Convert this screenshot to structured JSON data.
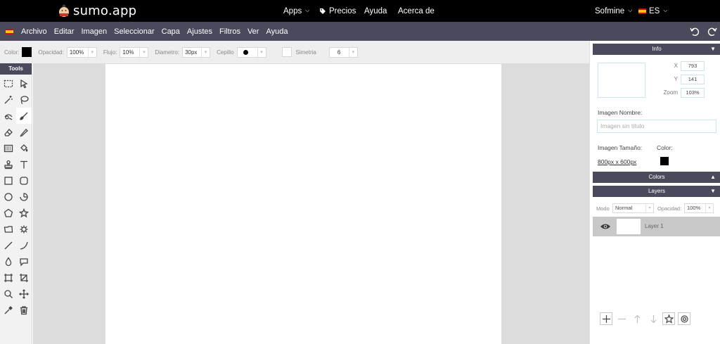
{
  "site": {
    "logo_text": "sumo.app",
    "nav": [
      {
        "label": "Apps",
        "icon": "chevron-down-icon"
      },
      {
        "label": "Precios",
        "icon": "tag-icon"
      },
      {
        "label": "Ayuda"
      },
      {
        "label": "Acerca de"
      }
    ],
    "user": "Sofmine",
    "language": "ES"
  },
  "menu": {
    "items": [
      "Archivo",
      "Editar",
      "Imagen",
      "Seleccionar",
      "Capa",
      "Ajustes",
      "Filtros",
      "Ver",
      "Ayuda"
    ]
  },
  "options": {
    "color_label": "Color:",
    "color_value": "#000000",
    "opacity_label": "Opacidad:",
    "opacity_value": "100%",
    "flow_label": "Flujo:",
    "flow_value": "10%",
    "diameter_label": "Diametro:",
    "diameter_value": "30px",
    "brush_label": "Cepillo",
    "symmetry_label": "Simetria",
    "symmetry_value": "6"
  },
  "tools": {
    "title": "Tools",
    "active": "brush-tool",
    "items": [
      "rect-select-icon",
      "pointer-icon",
      "magic-wand-icon",
      "lasso-icon",
      "clone-icon",
      "brush-icon",
      "eraser-icon",
      "pencil-icon",
      "gradient-icon",
      "fill-icon",
      "stamp-icon",
      "text-icon",
      "square-icon",
      "rounded-square-icon",
      "circle-icon",
      "pie-icon",
      "pentagon-icon",
      "star-icon",
      "polygon-icon",
      "gear-shape-icon",
      "line-icon",
      "curve-icon",
      "drop-icon",
      "speech-bubble-icon",
      "frame-icon",
      "crop-icon",
      "zoom-icon",
      "move-icon",
      "eyedropper-icon",
      "trash-icon"
    ]
  },
  "info": {
    "title": "Info",
    "x_label": "X",
    "x_value": "793",
    "y_label": "Y",
    "y_value": "141",
    "zoom_label": "Zoom",
    "zoom_value": "103%",
    "name_label": "Imagen Nombre:",
    "name_placeholder": "Imagen sin título",
    "size_label": "Imagen Tamaño:",
    "size_value": "800px x 600px",
    "color_label": "Color:",
    "color_value": "#000000"
  },
  "colors_panel": {
    "title": "Colors"
  },
  "layers": {
    "title": "Layers",
    "mode_label": "Modo",
    "mode_value": "Normal",
    "opacity_label": "Opacidad:",
    "opacity_value": "100%",
    "items": [
      {
        "name": "Layer 1",
        "visible": true
      }
    ]
  },
  "theme": {
    "topbar": "#000000",
    "menubar": "#4a4a5c",
    "workspace": "#dcdcdc"
  }
}
